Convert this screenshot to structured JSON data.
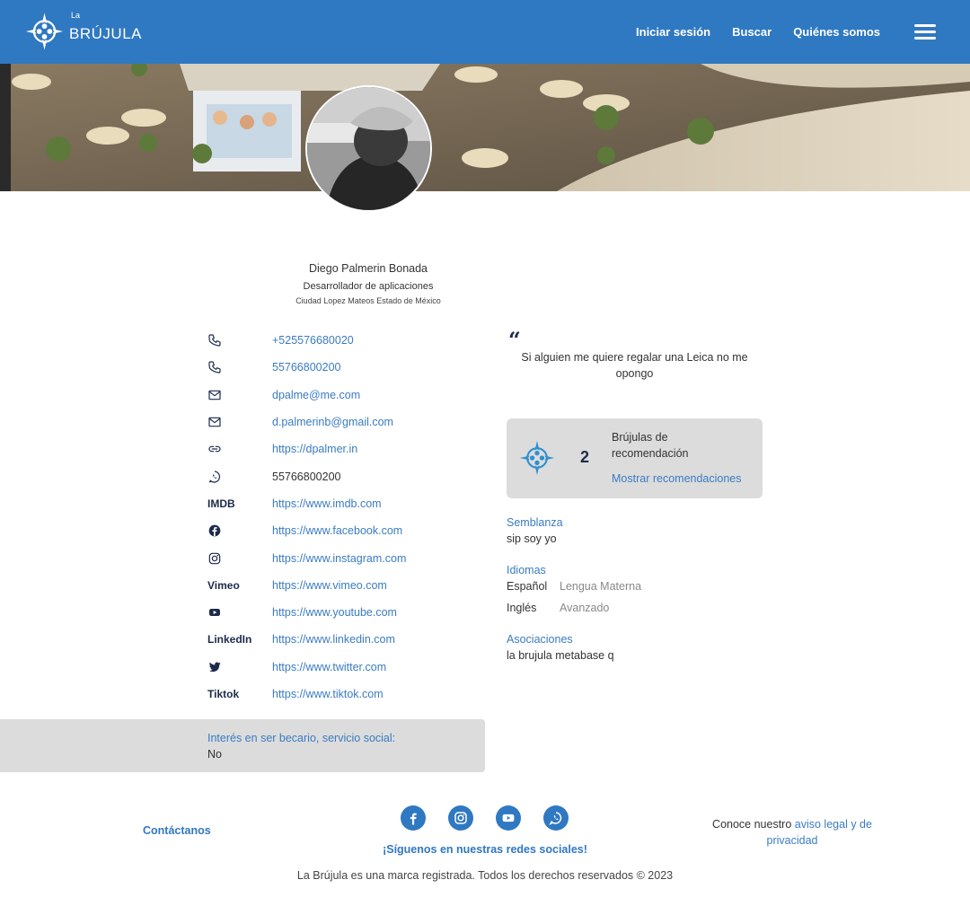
{
  "header": {
    "logo_small": "La",
    "logo_big": "BRÚJULA",
    "nav": [
      "Iniciar sesión",
      "Buscar",
      "Quiénes somos"
    ]
  },
  "profile": {
    "name": "Diego Palmerin Bonada",
    "role": "Desarrollador de aplicaciones",
    "location": "Ciudad Lopez Mateos Estado de México"
  },
  "contacts": [
    {
      "icon": "phone-icon",
      "label": "",
      "value": "+525576680020",
      "link": true
    },
    {
      "icon": "phone-icon",
      "label": "",
      "value": "55766800200",
      "link": true
    },
    {
      "icon": "mail-icon",
      "label": "",
      "value": "dpalme@me.com",
      "link": true
    },
    {
      "icon": "mail-icon",
      "label": "",
      "value": "d.palmerinb@gmail.com",
      "link": true
    },
    {
      "icon": "link-icon",
      "label": "",
      "value": "https://dpalmer.in",
      "link": true
    },
    {
      "icon": "whatsapp-icon",
      "label": "",
      "value": "55766800200",
      "link": false
    },
    {
      "icon": "",
      "label": "IMDB",
      "value": "https://www.imdb.com",
      "link": true
    },
    {
      "icon": "facebook-icon",
      "label": "",
      "value": "https://www.facebook.com",
      "link": true
    },
    {
      "icon": "instagram-icon",
      "label": "",
      "value": "https://www.instagram.com",
      "link": true
    },
    {
      "icon": "",
      "label": "Vimeo",
      "value": "https://www.vimeo.com",
      "link": true
    },
    {
      "icon": "youtube-icon",
      "label": "",
      "value": "https://www.youtube.com",
      "link": true
    },
    {
      "icon": "",
      "label": "LinkedIn",
      "value": "https://www.linkedin.com",
      "link": true
    },
    {
      "icon": "twitter-icon",
      "label": "",
      "value": "https://www.twitter.com",
      "link": true
    },
    {
      "icon": "",
      "label": "Tiktok",
      "value": "https://www.tiktok.com",
      "link": true
    }
  ],
  "becario": {
    "label": "Interés en ser becario, servicio social:",
    "value": "No"
  },
  "quote": {
    "mark": "“",
    "text": "Si alguien me quiere regalar una Leica no me opongo"
  },
  "recommendations": {
    "count": "2",
    "title": "Brújulas de recomendación",
    "link": "Mostrar recomendaciones"
  },
  "semblanza": {
    "label": "Semblanza",
    "value": "sip soy yo"
  },
  "idiomas": {
    "label": "Idiomas",
    "items": [
      {
        "name": "Español",
        "level": "Lengua Materna"
      },
      {
        "name": "Inglés",
        "level": "Avanzado"
      }
    ]
  },
  "asociaciones": {
    "label": "Asociaciones",
    "value": "la brujula metabase q"
  },
  "footer": {
    "contact": "Contáctanos",
    "follow": "¡Síguenos en nuestras redes sociales!",
    "legal_prefix": "Conoce nuestro ",
    "legal_link": "aviso legal y de privacidad",
    "copyright": "La Brújula es una marca registrada. Todos los derechos reservados © 2023"
  },
  "colors": {
    "brand": "#2f78c2",
    "link": "#3a7cc2",
    "panel": "#dcdcdc",
    "dark": "#1d2a4a"
  }
}
